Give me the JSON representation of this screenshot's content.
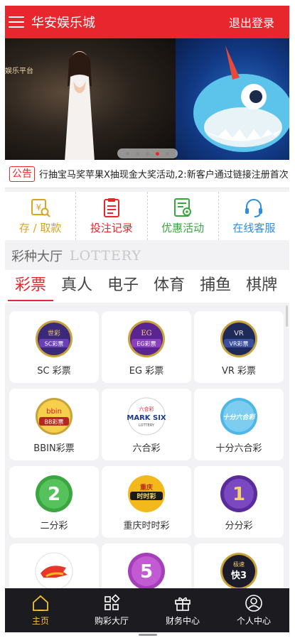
{
  "header": {
    "title": "华安娱乐城",
    "logout": "退出登录"
  },
  "banner": {
    "left_sign": "娱乐平台",
    "slides": 5,
    "active_slide": 4
  },
  "notice": {
    "badge": "公告",
    "text": "行抽宝马奖苹果X抽现金大奖活动,2:新客户通过链接注册首次"
  },
  "quick_actions": [
    {
      "label": "存 / 取款",
      "icon": "wallet-search-icon",
      "color": "#d9a520"
    },
    {
      "label": "投注记录",
      "icon": "clipboard-icon",
      "color": "#e8262d"
    },
    {
      "label": "优惠活动",
      "icon": "promo-doc-icon",
      "color": "#3aa640"
    },
    {
      "label": "在线客服",
      "icon": "headset-icon",
      "color": "#2f8ee0"
    }
  ],
  "section": {
    "title_cn": "彩种大厅",
    "title_en": "LOTTERY"
  },
  "tabs": [
    {
      "label": "彩票",
      "active": true
    },
    {
      "label": "真人"
    },
    {
      "label": "电子"
    },
    {
      "label": "体育"
    },
    {
      "label": "捕鱼"
    },
    {
      "label": "棋牌"
    }
  ],
  "games": [
    {
      "label": "SC 彩票",
      "badge": "SC彩票"
    },
    {
      "label": "EG 彩票",
      "badge": "EG彩票"
    },
    {
      "label": "VR 彩票",
      "badge": "VR彩票"
    },
    {
      "label": "BBIN彩票",
      "badge": "BB彩票"
    },
    {
      "label": "六合彩",
      "badge": "MARK SIX"
    },
    {
      "label": "十分六合彩",
      "badge": "十分六合彩"
    },
    {
      "label": "二分彩",
      "badge": "2"
    },
    {
      "label": "重庆时时彩",
      "badge": "时时彩"
    },
    {
      "label": "分分彩",
      "badge": "1"
    },
    {
      "label": "",
      "badge": ""
    },
    {
      "label": "",
      "badge": "5"
    },
    {
      "label": "",
      "badge": "快3"
    }
  ],
  "bottom_nav": [
    {
      "label": "主页",
      "icon": "home-icon",
      "active": true
    },
    {
      "label": "购彩大厅",
      "icon": "grid-icon"
    },
    {
      "label": "财务中心",
      "icon": "gift-icon"
    },
    {
      "label": "个人中心",
      "icon": "user-icon"
    }
  ]
}
